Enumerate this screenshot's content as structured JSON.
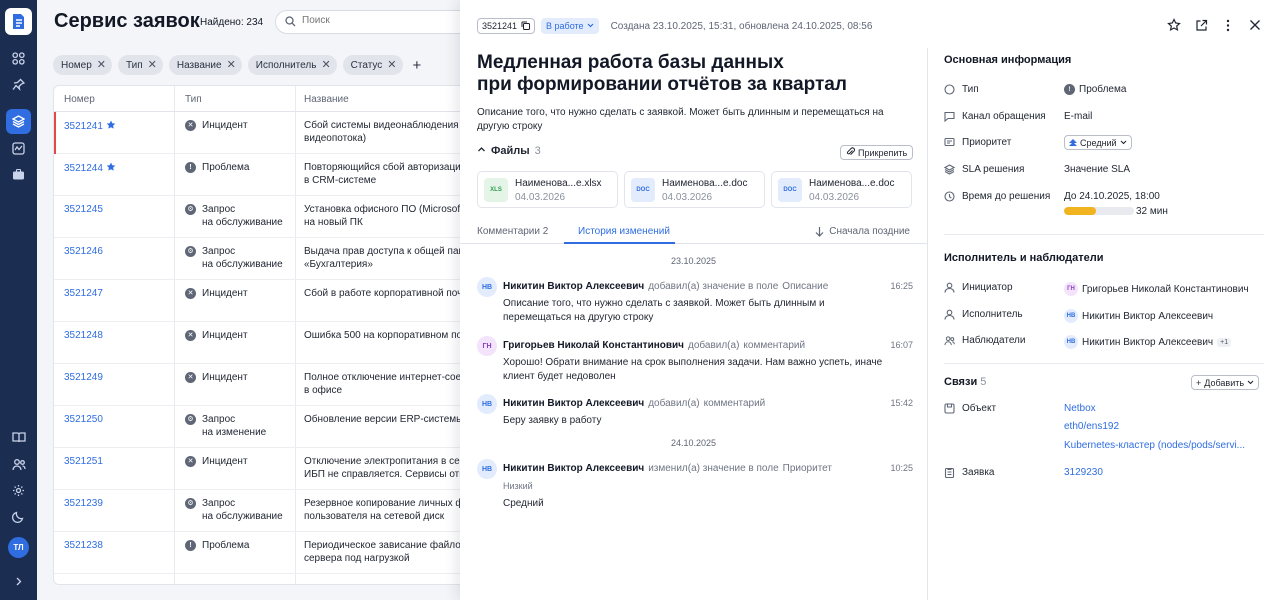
{
  "app": {
    "title": "Сервис заявок",
    "found_label": "Найдено: 234",
    "search_placeholder": "Поиск",
    "user_initials": "ТЛ"
  },
  "filters": [
    "Номер",
    "Тип",
    "Название",
    "Исполнитель",
    "Статус"
  ],
  "table": {
    "headers": [
      "Номер",
      "Тип",
      "Название"
    ],
    "rows": [
      {
        "num": "3521241",
        "star": true,
        "type": "Инцидент",
        "icon": "x-circle-icon",
        "name": "Сбой системы видеонаблюдения (не",
        "name2": "видеопотока)"
      },
      {
        "num": "3521244",
        "star": true,
        "type": "Проблема",
        "icon": "exclamation-circle-icon",
        "name": "Повторяющийся сбой авторизации",
        "name2": "в CRM-системе"
      },
      {
        "num": "3521245",
        "type": "Запрос",
        "type2": "на обслуживание",
        "icon": "gear-circle-icon",
        "name": "Установка офисного ПО (Microsoft O",
        "name2": "на новый ПК"
      },
      {
        "num": "3521246",
        "type": "Запрос",
        "type2": "на обслуживание",
        "icon": "gear-circle-icon",
        "name": "Выдача прав доступа к общей папке",
        "name2": "«Бухгалтерия»"
      },
      {
        "num": "3521247",
        "type": "Инцидент",
        "icon": "x-circle-icon",
        "name": "Сбой в работе корпоративной почты"
      },
      {
        "num": "3521248",
        "type": "Инцидент",
        "icon": "x-circle-icon",
        "name": "Ошибка 500 на корпоративном пор"
      },
      {
        "num": "3521249",
        "type": "Инцидент",
        "icon": "x-circle-icon",
        "name": "Полное отключение интернет-соеди",
        "name2": "в офисе"
      },
      {
        "num": "3521250",
        "type": "Запрос",
        "type2": "на изменение",
        "icon": "gear-circle-icon",
        "name": "Обновление версии ERP-системы до"
      },
      {
        "num": "3521251",
        "type": "Инцидент",
        "icon": "x-circle-icon",
        "name": "Отключение электропитания в серв",
        "name2": "ИБП не справляется. Сервисы отклю"
      },
      {
        "num": "3521239",
        "type": "Запрос",
        "type2": "на обслуживание",
        "icon": "gear-circle-icon",
        "name": "Резервное копирование личных фай",
        "name2": "пользователя на сетевой диск"
      },
      {
        "num": "3521238",
        "type": "Проблема",
        "icon": "exclamation-circle-icon",
        "name": "Периодическое зависание файлово",
        "name2": "сервера под нагрузкой"
      }
    ]
  },
  "detail": {
    "id": "3521241",
    "status": "В работе",
    "meta": "Создана 23.10.2025, 15:31, обновлена 24.10.2025, 08:56",
    "title_line1": "Медленная работа базы данных",
    "title_line2": "при формировании отчётов за квартал",
    "description": "Описание того, что нужно сделать с заявкой. Может быть длинным и перемещаться на другую строку",
    "files_label": "Файлы",
    "files_count": "3",
    "attach_label": "Прикрепить",
    "files": [
      {
        "name": "Наименова...e.xlsx",
        "date": "04.03.2026",
        "kind": "XLS"
      },
      {
        "name": "Наименова...e.doc",
        "date": "04.03.2026",
        "kind": "DOC"
      },
      {
        "name": "Наименова...e.doc",
        "date": "04.03.2026",
        "kind": "DOC"
      }
    ],
    "tabs": {
      "comments": "Комментарии",
      "comments_count": "2",
      "history": "История изменений",
      "sort": "Сначала поздние"
    },
    "history": [
      {
        "date_sep": "23.10.2025",
        "initials": "НВ",
        "author": "Никитин Виктор Алексеевич",
        "action": "добавил(а) значение в поле",
        "field": "Описание",
        "time": "16:25",
        "text": "Описание того, что нужно сделать с заявкой. Может быть длинным и перемещаться на другую строку"
      },
      {
        "initials": "ГН",
        "author": "Григорьев Николай Константинович",
        "action": "добавил(а)",
        "field": "комментарий",
        "time": "16:07",
        "text": "Хорошо! Обрати внимание на срок выполнения задачи. Нам важно успеть, иначе клиент будет недоволен"
      },
      {
        "initials": "НВ",
        "author": "Никитин Виктор Алексеевич",
        "action": "добавил(а)",
        "field": "комментарий",
        "time": "15:42",
        "text": "Беру заявку в работу"
      },
      {
        "date_sep": "24.10.2025",
        "initials": "НВ",
        "author": "Никитин Виктор Алексеевич",
        "action": "изменил(а) значение в поле",
        "field": "Приоритет",
        "time": "10:25",
        "old": "Низкий",
        "text": "Средний"
      }
    ]
  },
  "info": {
    "main_header": "Основная информация",
    "type_label": "Тип",
    "type_value": "Проблема",
    "channel_label": "Канал обращения",
    "channel_value": "E-mail",
    "priority_label": "Приоритет",
    "priority_value": "Средний",
    "sla_label": "SLA решения",
    "sla_value": "Значение SLA",
    "deadline_label": "Время до решения",
    "deadline_value": "До 24.10.2025, 18:00",
    "sla_remaining": "32 мин",
    "sla_progress": 0.45,
    "people_header": "Исполнитель и наблюдатели",
    "initiator_label": "Инициатор",
    "initiator_initials": "ГН",
    "initiator_value": "Григорьев Николай Константинович",
    "assignee_label": "Исполнитель",
    "assignee_initials": "НВ",
    "assignee_value": "Никитин Виктор Алексеевич",
    "watchers_label": "Наблюдатели",
    "watchers_initials": "НВ",
    "watchers_value": "Никитин Виктор Алексеевич",
    "watchers_more": "+1",
    "links_header": "Связи",
    "links_count": "5",
    "add_label": "Добавить",
    "object_label": "Объект",
    "objects": [
      "Netbox",
      "eth0/ens192",
      "Kubernetes-кластер (nodes/pods/servi..."
    ],
    "ticket_label": "Заявка",
    "ticket_value": "3129230"
  },
  "colors": {
    "accent": "#2f6de1",
    "rail": "#1c2d52",
    "selected": "#e54848",
    "sla": "#f2b320"
  }
}
